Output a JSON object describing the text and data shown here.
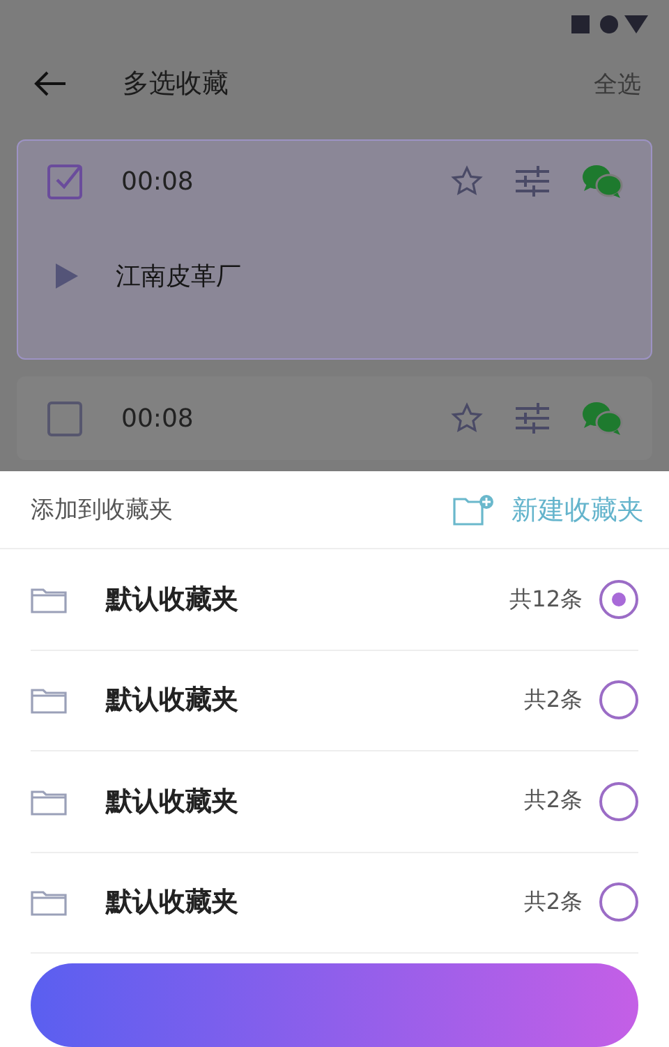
{
  "header": {
    "title": "多选收藏",
    "action": "全选"
  },
  "recordings": [
    {
      "time": "00:08",
      "title": "江南皮革厂",
      "checked": true
    },
    {
      "time": "00:08",
      "checked": false
    }
  ],
  "sheet": {
    "title": "添加到收藏夹",
    "new_folder": "新建收藏夹",
    "folders": [
      {
        "name": "默认收藏夹",
        "count": "共12条",
        "selected": true
      },
      {
        "name": "默认收藏夹",
        "count": "共2条",
        "selected": false
      },
      {
        "name": "默认收藏夹",
        "count": "共2条",
        "selected": false
      },
      {
        "name": "默认收藏夹",
        "count": "共2条",
        "selected": false
      }
    ]
  }
}
